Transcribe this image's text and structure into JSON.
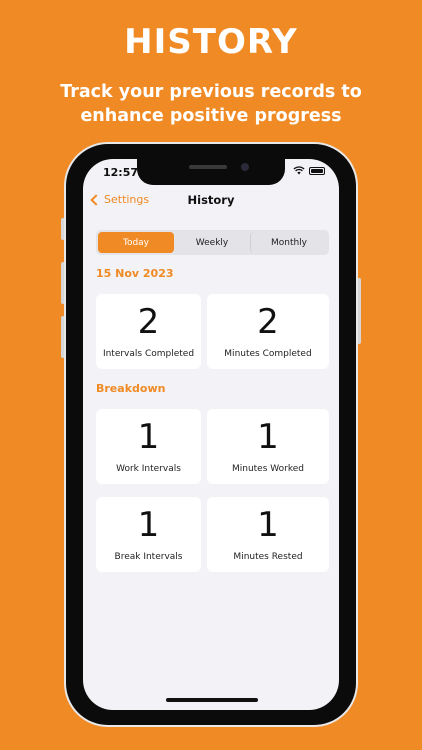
{
  "promo": {
    "title": "HISTORY",
    "subtitle": "Track your previous records to enhance positive progress"
  },
  "status_bar": {
    "time": "12:57"
  },
  "nav": {
    "back_label": "Settings",
    "title": "History"
  },
  "tabs": [
    {
      "label": "Today",
      "active": true
    },
    {
      "label": "Weekly",
      "active": false
    },
    {
      "label": "Monthly",
      "active": false
    }
  ],
  "summary": {
    "date": "15 Nov 2023",
    "cards": [
      {
        "value": "2",
        "label": "Intervals Completed"
      },
      {
        "value": "2",
        "label": "Minutes Completed"
      }
    ]
  },
  "breakdown": {
    "title": "Breakdown",
    "cards": [
      {
        "value": "1",
        "label": "Work Intervals"
      },
      {
        "value": "1",
        "label": "Minutes Worked"
      },
      {
        "value": "1",
        "label": "Break Intervals"
      },
      {
        "value": "1",
        "label": "Minutes Rested"
      }
    ]
  },
  "colors": {
    "accent": "#F08A24",
    "background": "#F2F2F7",
    "card": "#FFFFFF"
  }
}
